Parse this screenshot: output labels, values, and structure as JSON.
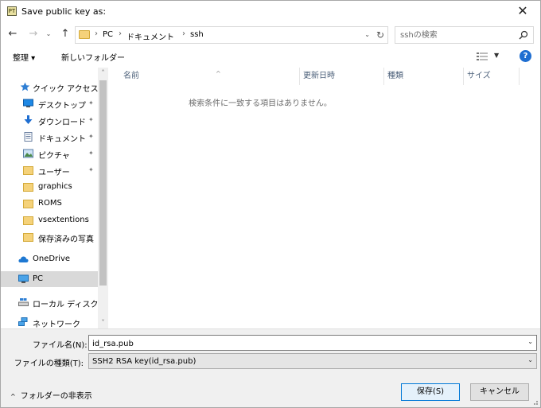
{
  "window": {
    "title": "Save public key as:",
    "app_icon_glyph": "PT",
    "close_glyph": "✕"
  },
  "nav": {
    "back_glyph": "←",
    "forward_glyph": "→",
    "recent_glyph": "⌄",
    "up_glyph": "↑",
    "address": {
      "segments": [
        "PC",
        "ドキュメント",
        "ssh"
      ],
      "separator_glyph": "›",
      "dropdown_glyph": "⌄",
      "refresh_glyph": "↻"
    },
    "search_placeholder": "sshの検索"
  },
  "toolbar": {
    "organize_label": "整理 ▾",
    "new_folder_label": "新しいフォルダー",
    "view_dropdown_glyph": "▼",
    "help_glyph": "?"
  },
  "navpane": {
    "pin_glyph": "📌",
    "items": [
      {
        "label": "クイック アクセス",
        "icon": "star-icon"
      },
      {
        "label": "デスクトップ",
        "icon": "desktop-icon",
        "pinned": true
      },
      {
        "label": "ダウンロード",
        "icon": "download-icon",
        "pinned": true
      },
      {
        "label": "ドキュメント",
        "icon": "document-icon",
        "pinned": true
      },
      {
        "label": "ピクチャ",
        "icon": "pictures-icon",
        "pinned": true
      },
      {
        "label": "ユーザー",
        "icon": "folder-icon",
        "pinned": true
      },
      {
        "label": "graphics",
        "icon": "folder-icon"
      },
      {
        "label": "ROMS",
        "icon": "folder-icon"
      },
      {
        "label": "vsextentions",
        "icon": "folder-icon"
      },
      {
        "label": "保存済みの写真",
        "icon": "folder-icon"
      },
      {
        "label": "OneDrive",
        "icon": "cloud-icon"
      },
      {
        "label": "PC",
        "icon": "computer-icon",
        "selected": true
      },
      {
        "label": "ローカル ディスク (C:)",
        "icon": "drive-icon"
      },
      {
        "label": "ネットワーク",
        "icon": "network-icon"
      }
    ],
    "scroll_up_glyph": "˄",
    "scroll_down_glyph": "˅"
  },
  "content": {
    "columns": [
      "名前",
      "更新日時",
      "種類",
      "サイズ"
    ],
    "sort_glyph": "^",
    "empty_message": "検索条件に一致する項目はありません。"
  },
  "bottom": {
    "filename_label": "ファイル名(N):",
    "filename_value": "id_rsa.pub",
    "filetype_label": "ファイルの種類(T):",
    "filetype_value": "SSH2 RSA key(id_rsa.pub)",
    "dropdown_glyph": "⌄",
    "hide_folders_chevron": "^",
    "hide_folders_label": "フォルダーの非表示",
    "save_label": "保存(S)",
    "cancel_label": "キャンセル"
  },
  "colors": {
    "selection": "#cce8ff",
    "pc_selected": "#d9d9d9",
    "accent": "#0078d7",
    "help": "#1e6ed1",
    "header_text": "#4c607a"
  }
}
